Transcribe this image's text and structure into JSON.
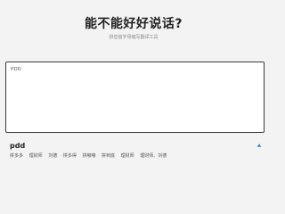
{
  "header": {
    "title": "能不能好好说话?",
    "subtitle": "拼音首字母缩写翻译工具"
  },
  "input": {
    "value": "PDD"
  },
  "result": {
    "word": "pdd",
    "translations": [
      "拼多多",
      "理财师",
      "刘德",
      "拼多得",
      "拼嘟嘟",
      "拼到底",
      "理财师",
      "理财师、刘德"
    ]
  },
  "colors": {
    "background": "#f3f3f3",
    "accent": "#3d7be0"
  },
  "icons": {
    "expand": "caret-up-icon"
  }
}
